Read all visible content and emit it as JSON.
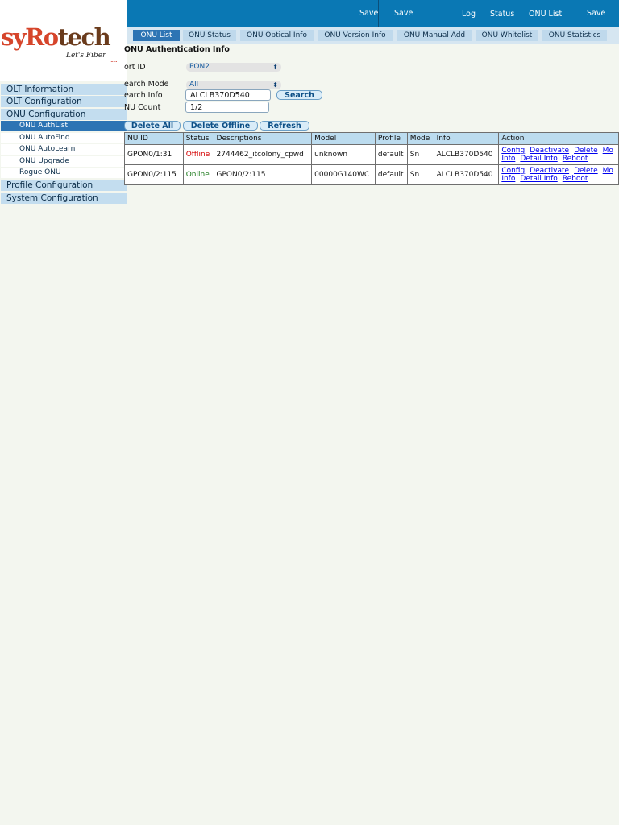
{
  "topbar": {
    "items": [
      "Save",
      "Save",
      "Log",
      "Status",
      "ONU List",
      "Save"
    ]
  },
  "logo": {
    "brand_part1": "syRo",
    "brand_part2": "tech",
    "tagline": "Let's Fiber",
    "dots": "....."
  },
  "tabs": [
    {
      "label": "ONU List",
      "active": true
    },
    {
      "label": "ONU Status",
      "active": false
    },
    {
      "label": "ONU Optical Info",
      "active": false
    },
    {
      "label": "ONU Version Info",
      "active": false
    },
    {
      "label": "ONU Manual Add",
      "active": false
    },
    {
      "label": "ONU Whitelist",
      "active": false
    },
    {
      "label": "ONU Statistics",
      "active": false
    }
  ],
  "sidebar": {
    "items": [
      {
        "label": "OLT Information"
      },
      {
        "label": "OLT Configuration"
      },
      {
        "label": "ONU Configuration"
      },
      {
        "label": "ONU AuthList",
        "active": true
      },
      {
        "label": "ONU AutoFind"
      },
      {
        "label": "ONU AutoLearn"
      },
      {
        "label": "ONU Upgrade"
      },
      {
        "label": "Rogue ONU"
      },
      {
        "label": "Profile Configuration"
      },
      {
        "label": "System Configuration"
      }
    ]
  },
  "page": {
    "title": "ONU Authentication Info"
  },
  "form": {
    "port_id_label": "ort ID",
    "port_id_value": "PON2",
    "search_mode_label": "earch Mode",
    "search_mode_value": "All",
    "search_info_label": "earch Info",
    "search_info_value": "ALCLB370D540",
    "search_button": "Search",
    "onu_count_label": "NU Count",
    "onu_count_value": "1/2"
  },
  "actions": {
    "delete_all": "Delete All",
    "delete_offline": "Delete Offline",
    "refresh": "Refresh"
  },
  "table": {
    "headers": [
      "NU ID",
      "Status",
      "Descriptions",
      "Model",
      "Profile",
      "Mode",
      "Info",
      "Action"
    ],
    "rows": [
      {
        "onu_id": "GPON0/1:31",
        "status": "Offline",
        "description": "2744462_itcolony_cpwd",
        "model": "unknown",
        "profile": "default",
        "mode": "Sn",
        "info": "ALCLB370D540",
        "actions_line1": [
          "Config",
          "Deactivate",
          "Delete",
          "Mo"
        ],
        "actions_line2": [
          "Info",
          "Detail Info",
          "Reboot"
        ]
      },
      {
        "onu_id": "GPON0/2:115",
        "status": "Online",
        "description": "GPON0/2:115",
        "model": "00000G140WC",
        "profile": "default",
        "mode": "Sn",
        "info": "ALCLB370D540",
        "actions_line1": [
          "Config",
          "Deactivate",
          "Delete",
          "Mo"
        ],
        "actions_line2": [
          "Info",
          "Detail Info",
          "Reboot"
        ]
      }
    ]
  },
  "colors": {
    "topbar": "#0a78b4",
    "nav_bg": "#c3ddef",
    "active": "#2d74b4",
    "offline": "#d40000",
    "online": "#1c7a1c"
  }
}
